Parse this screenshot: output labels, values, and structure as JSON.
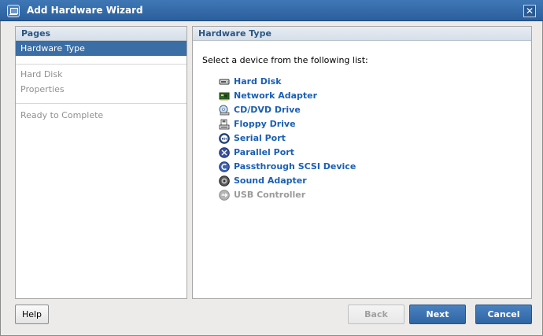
{
  "window": {
    "title": "Add Hardware Wizard",
    "close_glyph": "✕"
  },
  "pages_panel": {
    "header": "Pages",
    "items": [
      {
        "label": "Hardware Type",
        "selected": true,
        "enabled": true
      },
      {
        "label": "Hard Disk",
        "selected": false,
        "enabled": false
      },
      {
        "label": "Properties",
        "selected": false,
        "enabled": false
      },
      {
        "label": "Ready to Complete",
        "selected": false,
        "enabled": false
      }
    ]
  },
  "main_panel": {
    "header": "Hardware Type",
    "instruction": "Select a device from the following list:",
    "devices": [
      {
        "label": "Hard Disk",
        "icon": "hard-disk-icon",
        "enabled": true
      },
      {
        "label": "Network Adapter",
        "icon": "network-adapter-icon",
        "enabled": true
      },
      {
        "label": "CD/DVD Drive",
        "icon": "cd-dvd-drive-icon",
        "enabled": true
      },
      {
        "label": "Floppy Drive",
        "icon": "floppy-drive-icon",
        "enabled": true
      },
      {
        "label": "Serial Port",
        "icon": "serial-port-icon",
        "enabled": true
      },
      {
        "label": "Parallel Port",
        "icon": "parallel-port-icon",
        "enabled": true
      },
      {
        "label": "Passthrough SCSI Device",
        "icon": "scsi-device-icon",
        "enabled": true
      },
      {
        "label": "Sound Adapter",
        "icon": "sound-adapter-icon",
        "enabled": true
      },
      {
        "label": "USB Controller",
        "icon": "usb-controller-icon",
        "enabled": false
      }
    ]
  },
  "buttons": {
    "help": "Help",
    "back": "Back",
    "next": "Next",
    "cancel": "Cancel"
  },
  "colors": {
    "titlebar": "#2b5f9c",
    "selection": "#3a6ea5",
    "link": "#1a5fb4",
    "disabled": "#9a9a9a"
  }
}
